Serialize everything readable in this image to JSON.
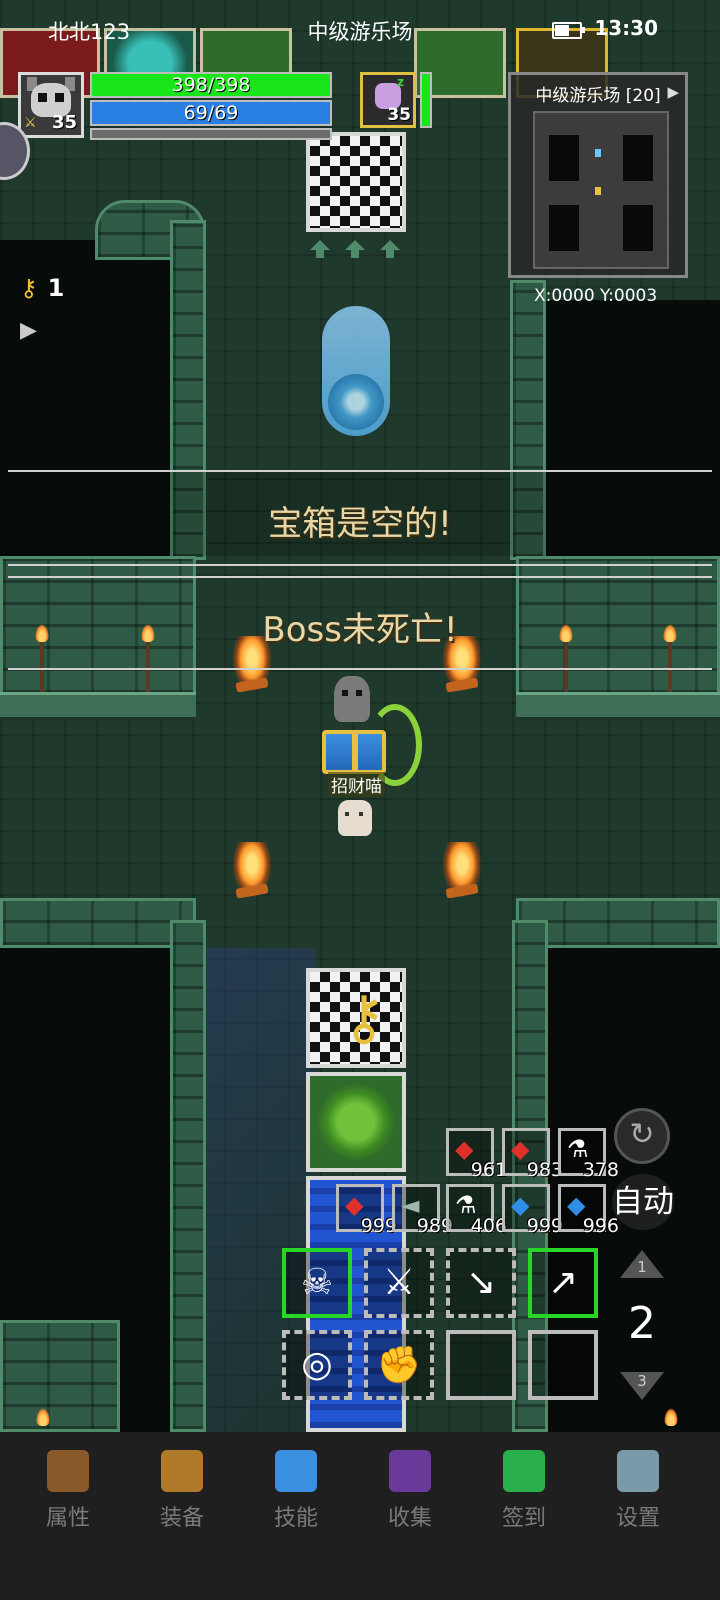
{
  "status_bar": {
    "user": "北北123",
    "location": "中级游乐场",
    "time": "13:30"
  },
  "player": {
    "level": "35",
    "hp_text": "398/398",
    "hp_fraction": 1.0,
    "mp_text": "69/69",
    "mp_fraction": 1.0,
    "xp_fraction": 0.0
  },
  "pet": {
    "level": "35",
    "hp_fraction": 1.0
  },
  "minimap": {
    "title": "中级游乐场 [20]",
    "coords": "X:0000  Y:0003"
  },
  "keys": {
    "count": "1"
  },
  "messages": {
    "chest_empty": "宝箱是空的!",
    "boss_alive": "Boss未死亡!"
  },
  "pet_label": "招财喵",
  "items": [
    {
      "icon": "meat-red",
      "count": "961"
    },
    {
      "icon": "meat-red",
      "count": "983"
    },
    {
      "icon": "vial-red",
      "count": "378"
    },
    {
      "icon": "meat-red",
      "count": "999"
    },
    {
      "icon": "fish-grey",
      "count": "989"
    },
    {
      "icon": "vial-red",
      "count": "406"
    },
    {
      "icon": "fish-blue",
      "count": "999"
    },
    {
      "icon": "fish-blue",
      "count": "996"
    }
  ],
  "controls": {
    "auto_label": "自动",
    "floor_up": "1",
    "floor_current": "2",
    "floor_down": "3"
  },
  "nav": [
    {
      "icon": "helmet-icon",
      "label": "属性",
      "color": "#8a5a2a"
    },
    {
      "icon": "bag-icon",
      "label": "装备",
      "color": "#b07a2a"
    },
    {
      "icon": "crystal-icon",
      "label": "技能",
      "color": "#3a8fe0"
    },
    {
      "icon": "book-icon",
      "label": "收集",
      "color": "#6a3a9a"
    },
    {
      "icon": "gem-icon",
      "label": "签到",
      "color": "#2ab04a"
    },
    {
      "icon": "gear-icon",
      "label": "设置",
      "color": "#7a9aaa"
    }
  ]
}
